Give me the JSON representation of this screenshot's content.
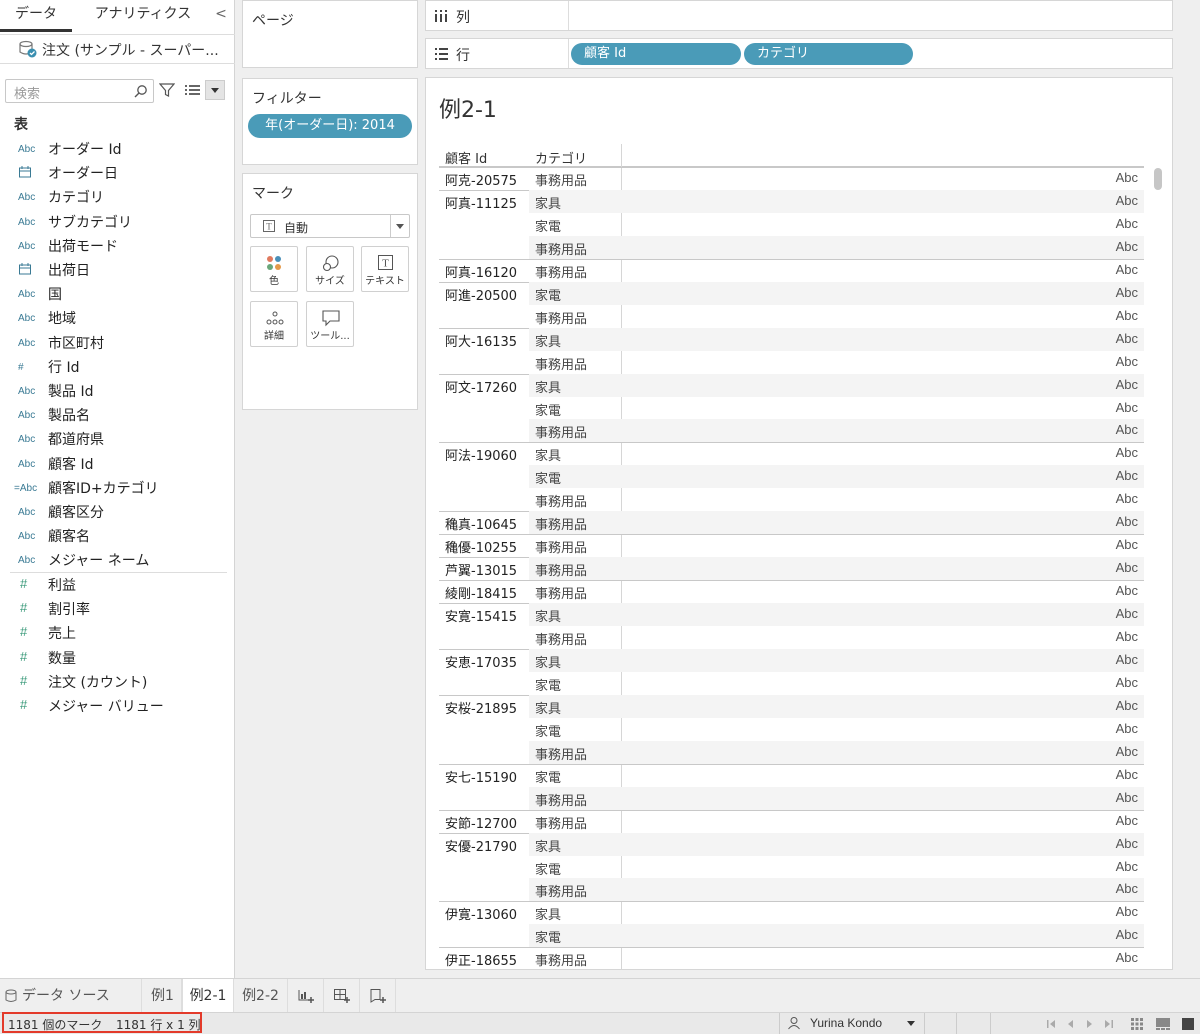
{
  "tabs": {
    "data": "データ",
    "analytics": "アナリティクス",
    "collapse": "<"
  },
  "datasource": "注文 (サンプル - スーパー...",
  "search": {
    "placeholder": "検索"
  },
  "table_section": "表",
  "dimensions": [
    {
      "type": "Abc",
      "name": "オーダー Id"
    },
    {
      "type": "date",
      "name": "オーダー日"
    },
    {
      "type": "Abc",
      "name": "カテゴリ"
    },
    {
      "type": "Abc",
      "name": "サブカテゴリ"
    },
    {
      "type": "Abc",
      "name": "出荷モード"
    },
    {
      "type": "date",
      "name": "出荷日"
    },
    {
      "type": "Abc",
      "name": "国"
    },
    {
      "type": "Abc",
      "name": "地域"
    },
    {
      "type": "Abc",
      "name": "市区町村"
    },
    {
      "type": "#",
      "name": "行 Id"
    },
    {
      "type": "Abc",
      "name": "製品 Id"
    },
    {
      "type": "Abc",
      "name": "製品名"
    },
    {
      "type": "Abc",
      "name": "都道府県"
    },
    {
      "type": "Abc",
      "name": "顧客 Id"
    },
    {
      "type": "=Abc",
      "name": "顧客ID+カテゴリ"
    },
    {
      "type": "Abc",
      "name": "顧客区分"
    },
    {
      "type": "Abc",
      "name": "顧客名"
    },
    {
      "type": "Abc",
      "name": "メジャー ネーム"
    }
  ],
  "measures": [
    {
      "type": "#",
      "name": "利益"
    },
    {
      "type": "#",
      "name": "割引率"
    },
    {
      "type": "#",
      "name": "売上"
    },
    {
      "type": "#",
      "name": "数量"
    },
    {
      "type": "#",
      "name": "注文 (カウント)"
    },
    {
      "type": "#",
      "name": "メジャー バリュー"
    }
  ],
  "pages_title": "ページ",
  "filters": {
    "title": "フィルター",
    "pill": "年(オーダー日): 2014"
  },
  "marks": {
    "title": "マーク",
    "type": "自動",
    "buttons": [
      "色",
      "サイズ",
      "テキスト",
      "詳細",
      "ツール..."
    ]
  },
  "columns_shelf": {
    "label": "列"
  },
  "rows_shelf": {
    "label": "行",
    "pills": [
      "顧客 Id",
      "カテゴリ"
    ]
  },
  "view": {
    "title": "例2-1",
    "headers": [
      "顧客 Id",
      "カテゴリ"
    ],
    "cell_text": "Abc",
    "groups": [
      {
        "id": "阿克-20575",
        "cats": [
          "事務用品"
        ]
      },
      {
        "id": "阿真-11125",
        "cats": [
          "家具",
          "家電",
          "事務用品"
        ]
      },
      {
        "id": "阿真-16120",
        "cats": [
          "事務用品"
        ]
      },
      {
        "id": "阿進-20500",
        "cats": [
          "家電",
          "事務用品"
        ]
      },
      {
        "id": "阿大-16135",
        "cats": [
          "家具",
          "事務用品"
        ]
      },
      {
        "id": "阿文-17260",
        "cats": [
          "家具",
          "家電",
          "事務用品"
        ]
      },
      {
        "id": "阿法-19060",
        "cats": [
          "家具",
          "家電",
          "事務用品"
        ]
      },
      {
        "id": "穐真-10645",
        "cats": [
          "事務用品"
        ]
      },
      {
        "id": "穐優-10255",
        "cats": [
          "事務用品"
        ]
      },
      {
        "id": "芦翼-13015",
        "cats": [
          "事務用品"
        ]
      },
      {
        "id": "綾剛-18415",
        "cats": [
          "事務用品"
        ]
      },
      {
        "id": "安寛-15415",
        "cats": [
          "家具",
          "事務用品"
        ]
      },
      {
        "id": "安恵-17035",
        "cats": [
          "家具",
          "家電"
        ]
      },
      {
        "id": "安桜-21895",
        "cats": [
          "家具",
          "家電",
          "事務用品"
        ]
      },
      {
        "id": "安七-15190",
        "cats": [
          "家電",
          "事務用品"
        ]
      },
      {
        "id": "安節-12700",
        "cats": [
          "事務用品"
        ]
      },
      {
        "id": "安優-21790",
        "cats": [
          "家具",
          "家電",
          "事務用品"
        ]
      },
      {
        "id": "伊寛-13060",
        "cats": [
          "家具",
          "家電"
        ]
      },
      {
        "id": "伊正-18655",
        "cats": [
          "事務用品"
        ]
      }
    ]
  },
  "sheet_tabs": {
    "datasource": "データ ソース",
    "sheets": [
      "例1",
      "例2-1",
      "例2-2"
    ],
    "active": "例2-1"
  },
  "status": {
    "marks": "1181 個のマーク",
    "dims": "1181 行 x 1 列",
    "user": "Yurina Kondo"
  },
  "colors": {
    "pill": "#4a9bb8",
    "highlight": "#e33a2a"
  }
}
